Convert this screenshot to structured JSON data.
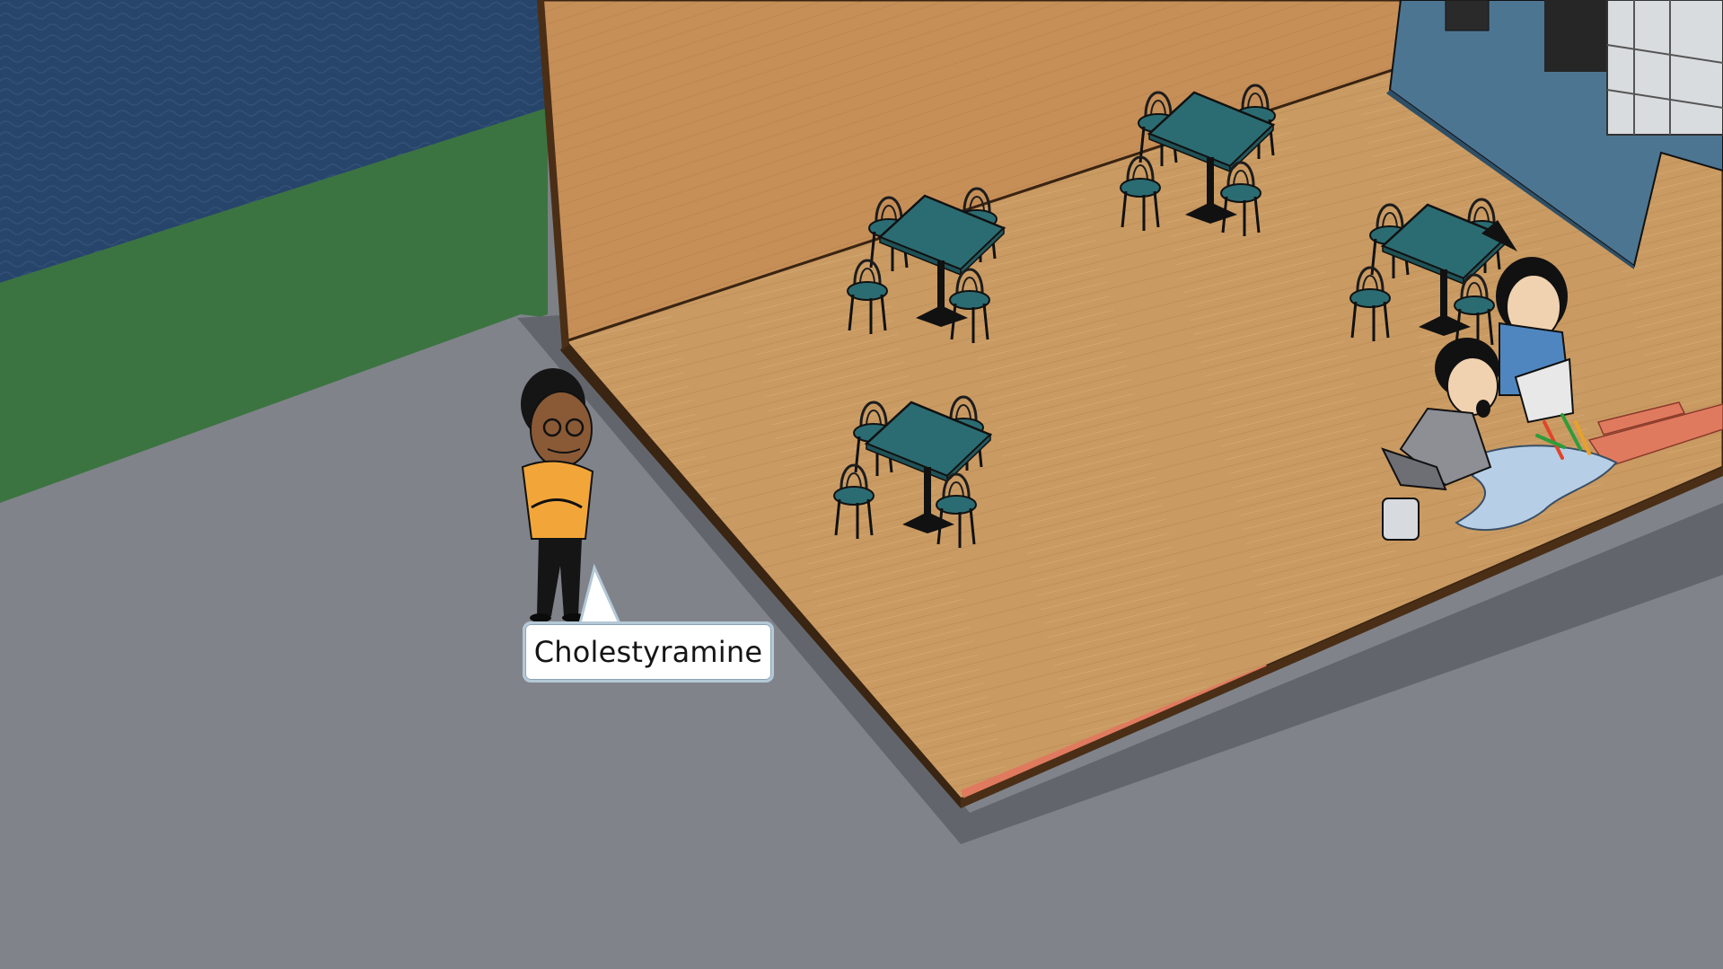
{
  "scene": {
    "speech_bubble": {
      "text": "Cholestyramine"
    },
    "characters": [
      {
        "role": "standing-man",
        "pose": "arms-crossed",
        "shirt_color": "#f2a63a"
      },
      {
        "role": "worker-woman",
        "pose": "dropping-tray",
        "shirt_color": "#4f86c0"
      },
      {
        "role": "kneeling-man",
        "pose": "crouching",
        "shirt_color": "#8e8f95"
      }
    ],
    "furniture": {
      "table_count": 4,
      "table_color": "#2b6c72",
      "floor_color": "#c89a62"
    },
    "colors": {
      "sea": "#27456a",
      "grass": "#3b7440",
      "road": "#80838a",
      "wall": "#c7945d",
      "counter": "#4c7592",
      "accent_strip": "#e07a5f"
    }
  }
}
